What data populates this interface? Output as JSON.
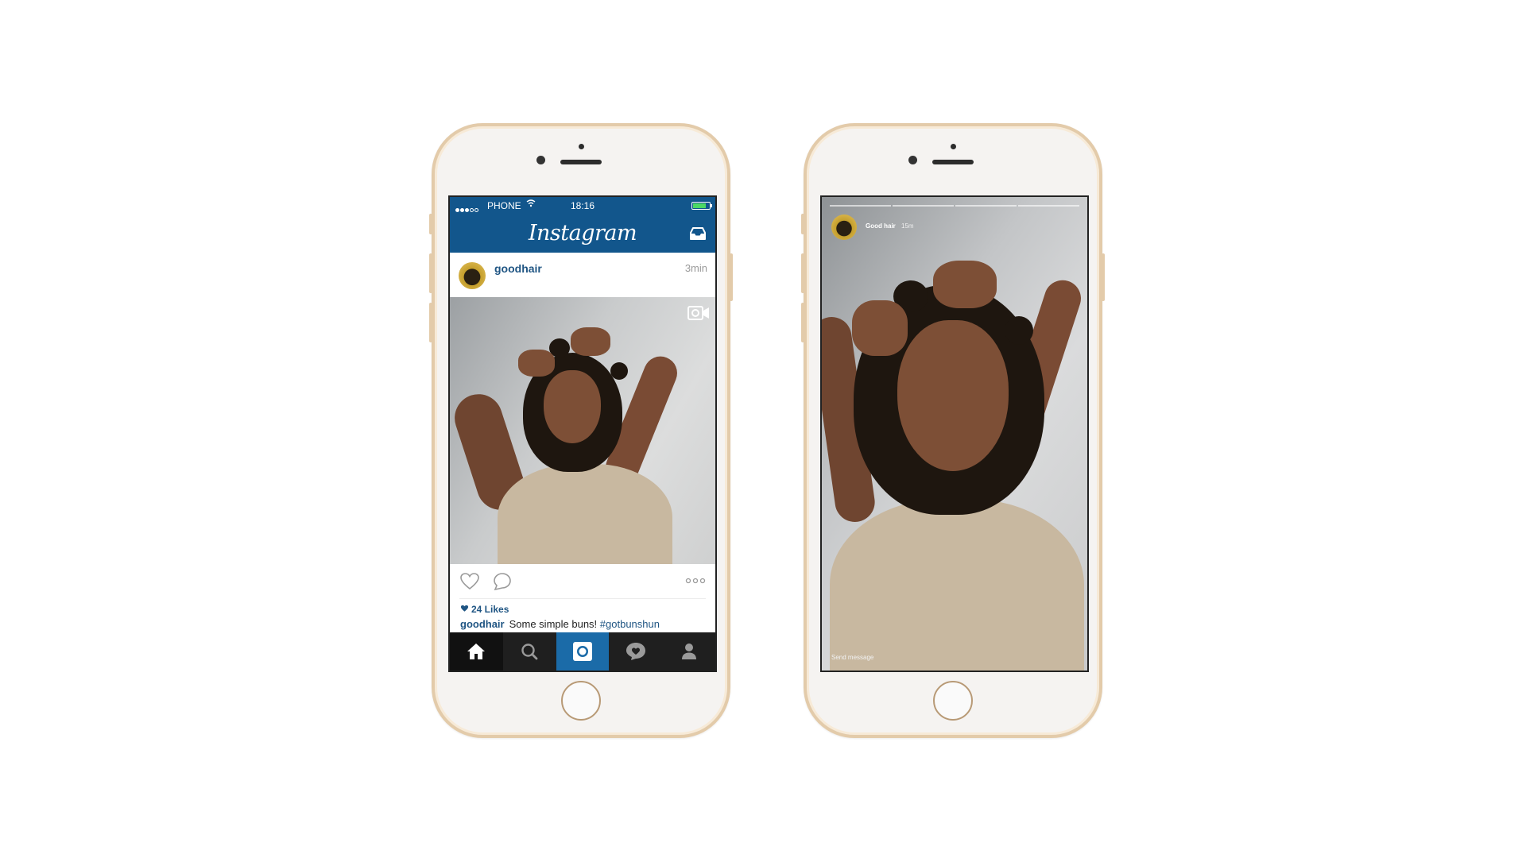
{
  "left_phone": {
    "status_bar": {
      "carrier": "PHONE",
      "time": "18:16"
    },
    "header": {
      "logo": "Instagram",
      "inbox_icon": "inbox-icon"
    },
    "post": {
      "username": "goodhair",
      "time": "3min",
      "likes": "24 Likes",
      "caption_user": "goodhair",
      "caption_text": "Some simple buns!",
      "caption_tag": "#gotbunshun"
    },
    "tabbar": [
      "home-icon",
      "search-icon",
      "camera-icon",
      "activity-icon",
      "profile-icon"
    ],
    "colors": {
      "brand": "#12568c",
      "tab_active": "#1b6ba8",
      "link": "#1f5583"
    }
  },
  "right_phone": {
    "story": {
      "username": "Good hair",
      "time": "15m",
      "send_message": "Send message"
    }
  }
}
